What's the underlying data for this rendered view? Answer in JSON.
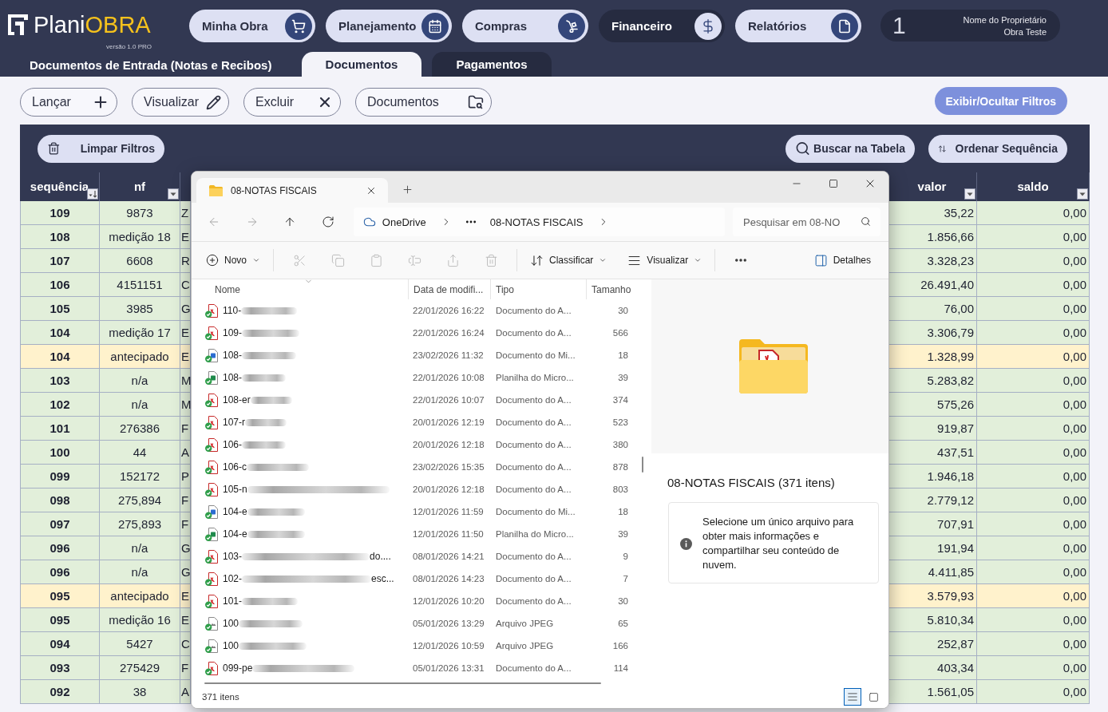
{
  "header": {
    "logo": {
      "brand_first": "Plani",
      "brand_second": "OBRA",
      "version": "versão 1.0 PRO"
    },
    "nav": [
      {
        "label": "Minha Obra",
        "selected": false
      },
      {
        "label": "Planejamento",
        "selected": false
      },
      {
        "label": "Compras",
        "selected": false
      },
      {
        "label": "Financeiro",
        "selected": true
      },
      {
        "label": "Relatórios",
        "selected": false
      }
    ],
    "user": {
      "number": "1",
      "owner": "Nome do Proprietário",
      "project": "Obra Teste"
    },
    "page_title": "Documentos de Entrada (Notas e Recibos)",
    "tabs": [
      {
        "label": "Documentos",
        "selected": true
      },
      {
        "label": "Pagamentos",
        "selected": false
      }
    ]
  },
  "toolbar": {
    "actions": [
      "Lançar",
      "Visualizar",
      "Excluir",
      "Documentos"
    ],
    "filters_toggle": "Exibir/Ocultar Filtros"
  },
  "filter_bar": {
    "clear_filters": "Limpar Filtros",
    "search": "Buscar na Tabela",
    "sort": "Ordenar Sequência"
  },
  "table": {
    "columns": [
      {
        "label": "sequência",
        "sorted": true
      },
      {
        "label": "nf",
        "sorted": false
      },
      {
        "label": "valor",
        "sorted": false
      },
      {
        "label": "saldo",
        "sorted": false
      }
    ],
    "rows": [
      {
        "sequencia": "109",
        "nf": "9873",
        "column_3": "Z",
        "valor": "35,22",
        "saldo": "0,00",
        "highlighted": false
      },
      {
        "sequencia": "108",
        "nf": "medição 18",
        "column_3": "E",
        "valor": "1.856,66",
        "saldo": "0,00",
        "highlighted": false
      },
      {
        "sequencia": "107",
        "nf": "6608",
        "column_3": "R",
        "valor": "3.328,23",
        "saldo": "0,00",
        "highlighted": false
      },
      {
        "sequencia": "106",
        "nf": "4151151",
        "column_3": "C",
        "valor": "26.491,40",
        "saldo": "0,00",
        "highlighted": false
      },
      {
        "sequencia": "105",
        "nf": "3985",
        "column_3": "G",
        "valor": "76,00",
        "saldo": "0,00",
        "highlighted": false
      },
      {
        "sequencia": "104",
        "nf": "medição 17",
        "column_3": "E",
        "valor": "3.306,79",
        "saldo": "0,00",
        "highlighted": false
      },
      {
        "sequencia": "104",
        "nf": "antecipado",
        "column_3": "E",
        "valor": "1.328,99",
        "saldo": "0,00",
        "highlighted": true
      },
      {
        "sequencia": "103",
        "nf": "n/a",
        "column_3": "M",
        "valor": "5.283,82",
        "saldo": "0,00",
        "highlighted": false
      },
      {
        "sequencia": "102",
        "nf": "n/a",
        "column_3": "M",
        "valor": "575,26",
        "saldo": "0,00",
        "highlighted": false
      },
      {
        "sequencia": "101",
        "nf": "276386",
        "column_3": "F",
        "valor": "919,87",
        "saldo": "0,00",
        "highlighted": false
      },
      {
        "sequencia": "100",
        "nf": "44",
        "column_3": "A",
        "valor": "437,51",
        "saldo": "0,00",
        "highlighted": false
      },
      {
        "sequencia": "099",
        "nf": "152172",
        "column_3": "P",
        "valor": "1.946,18",
        "saldo": "0,00",
        "highlighted": false
      },
      {
        "sequencia": "098",
        "nf": "275,894",
        "column_3": "F",
        "valor": "2.779,12",
        "saldo": "0,00",
        "highlighted": false
      },
      {
        "sequencia": "097",
        "nf": "275,893",
        "column_3": "F",
        "valor": "707,91",
        "saldo": "0,00",
        "highlighted": false
      },
      {
        "sequencia": "096",
        "nf": "n/a",
        "column_3": "G",
        "valor": "191,94",
        "saldo": "0,00",
        "highlighted": false
      },
      {
        "sequencia": "096",
        "nf": "n/a",
        "column_3": "G",
        "valor": "4.411,85",
        "saldo": "0,00",
        "highlighted": false
      },
      {
        "sequencia": "095",
        "nf": "antecipado",
        "column_3": "E",
        "valor": "3.579,93",
        "saldo": "0,00",
        "highlighted": true
      },
      {
        "sequencia": "095",
        "nf": "medição 16",
        "column_3": "E",
        "valor": "5.810,34",
        "saldo": "0,00",
        "highlighted": false
      },
      {
        "sequencia": "094",
        "nf": "5427",
        "column_3": "C",
        "valor": "252,87",
        "saldo": "0,00",
        "highlighted": false
      },
      {
        "sequencia": "093",
        "nf": "275429",
        "column_3": "F",
        "valor": "403,34",
        "saldo": "0,00",
        "highlighted": false
      },
      {
        "sequencia": "092",
        "nf": "38",
        "column_3": "A",
        "valor": "1.561,05",
        "saldo": "0,00",
        "highlighted": false
      }
    ]
  },
  "explorer": {
    "tab_title": "08-NOTAS FISCAIS",
    "nav_buttons": [
      {
        "disabled": true
      },
      {
        "disabled": true
      },
      {
        "disabled": false
      },
      {
        "disabled": false
      }
    ],
    "breadcrumb": [
      "OneDrive",
      "08-NOTAS FISCAIS"
    ],
    "search_placeholder": "Pesquisar em 08-NO",
    "commands": {
      "new": "Novo",
      "sort": "Classificar",
      "view": "Visualizar",
      "details": "Detalhes"
    },
    "edit_actions": [
      {
        "disabled": true
      },
      {
        "disabled": true
      },
      {
        "disabled": true
      },
      {
        "disabled": true
      },
      {
        "disabled": true
      },
      {
        "disabled": true
      }
    ],
    "columns": [
      "Nome",
      "Data de modifi...",
      "Tipo",
      "Tamanho"
    ],
    "files": [
      {
        "name": "110-",
        "date": "22/01/2026 16:22",
        "type": "Documento do A...",
        "size": "30",
        "kind": "pdf"
      },
      {
        "name": "109-",
        "date": "22/01/2026 16:24",
        "type": "Documento do A...",
        "size": "566",
        "kind": "pdf"
      },
      {
        "name": "108-",
        "date": "23/02/2026 11:32",
        "type": "Documento do Mi...",
        "size": "18",
        "kind": "word"
      },
      {
        "name": "108-",
        "date": "22/01/2026 10:08",
        "type": "Planilha do Micro...",
        "size": "39",
        "kind": "excel"
      },
      {
        "name": "108-er",
        "date": "22/01/2026 10:07",
        "type": "Documento do A...",
        "size": "374",
        "kind": "pdf"
      },
      {
        "name": "107-r",
        "date": "20/01/2026 12:19",
        "type": "Documento do A...",
        "size": "523",
        "kind": "pdf"
      },
      {
        "name": "106-",
        "date": "20/01/2026 12:18",
        "type": "Documento do A...",
        "size": "380",
        "kind": "pdf"
      },
      {
        "name": "106-c",
        "date": "23/02/2026 15:35",
        "type": "Documento do A...",
        "size": "878",
        "kind": "pdf"
      },
      {
        "name": "105-n",
        "date": "20/01/2026 12:18",
        "type": "Documento do A...",
        "size": "803",
        "kind": "pdf"
      },
      {
        "name": "104-e",
        "date": "12/01/2026 11:59",
        "type": "Documento do Mi...",
        "size": "18",
        "kind": "word"
      },
      {
        "name": "104-e",
        "date": "12/01/2026 11:50",
        "type": "Planilha do Micro...",
        "size": "39",
        "kind": "excel"
      },
      {
        "name": "103-",
        "tail": "do....",
        "date": "08/01/2026 14:21",
        "type": "Documento do A...",
        "size": "9",
        "kind": "pdf"
      },
      {
        "name": "102-",
        "tail": "esc...",
        "date": "08/01/2026 14:23",
        "type": "Documento do A...",
        "size": "7",
        "kind": "pdf"
      },
      {
        "name": "101-",
        "date": "12/01/2026 10:20",
        "type": "Documento do A...",
        "size": "30",
        "kind": "pdf"
      },
      {
        "name": "100",
        "date": "05/01/2026 13:29",
        "type": "Arquivo JPEG",
        "size": "65",
        "kind": "jpeg"
      },
      {
        "name": "100",
        "date": "12/01/2026 10:59",
        "type": "Arquivo JPEG",
        "size": "166",
        "kind": "jpeg"
      },
      {
        "name": "099-pe",
        "date": "05/01/2026 13:31",
        "type": "Documento do A...",
        "size": "114",
        "kind": "pdf"
      }
    ],
    "details": {
      "title": "08-NOTAS FISCAIS (371 itens)",
      "info": "Selecione um único arquivo para obter mais informações e compartilhar seu conteúdo de nuvem."
    },
    "status": "371 itens",
    "views": [
      {
        "selected": true
      },
      {
        "selected": false
      }
    ]
  }
}
